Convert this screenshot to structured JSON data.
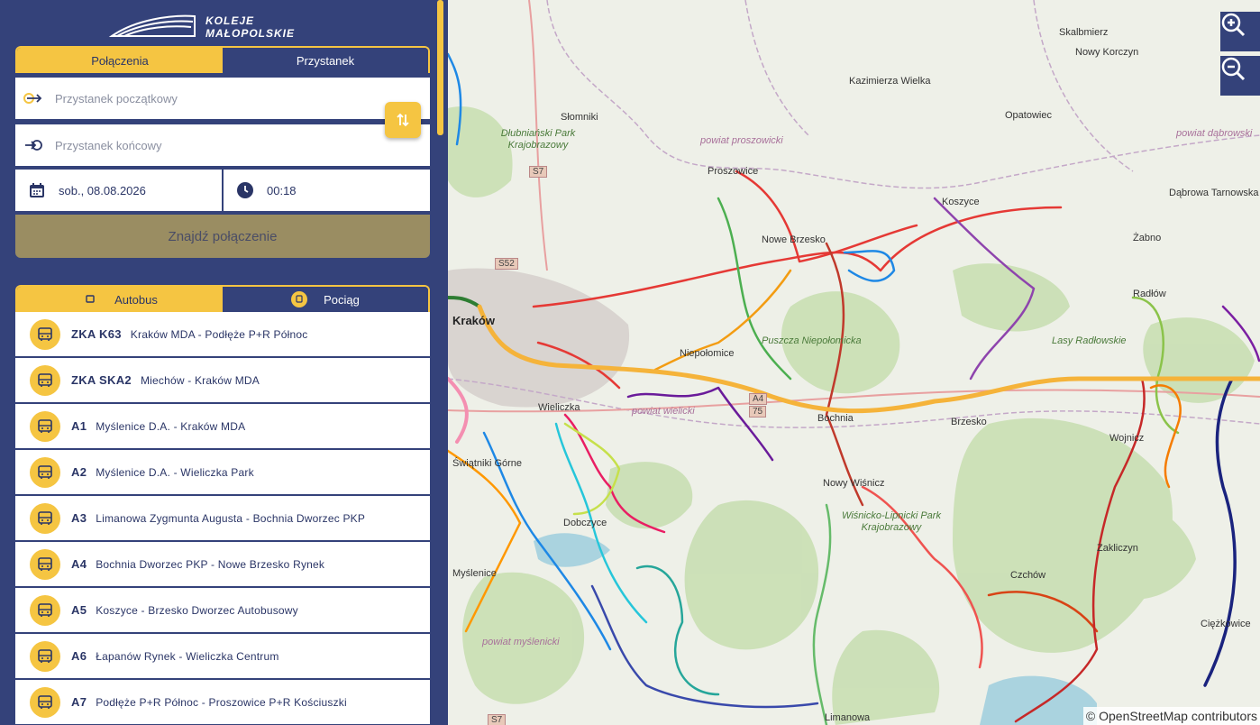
{
  "brand": {
    "line1": "KOLEJE",
    "line2": "MAŁOPOLSKIE"
  },
  "search_tabs": {
    "connections": "Połączenia",
    "stop": "Przystanek"
  },
  "search": {
    "from_placeholder": "Przystanek początkowy",
    "to_placeholder": "Przystanek końcowy",
    "date": "sob., 08.08.2026",
    "time": "00:18",
    "find_label": "Znajdź połączenie"
  },
  "mode_tabs": {
    "bus": "Autobus",
    "train": "Pociąg"
  },
  "routes": [
    {
      "code": "ZKA K63",
      "name": "Kraków MDA - Podłęże P+R Północ"
    },
    {
      "code": "ZKA SKA2",
      "name": "Miechów - Kraków MDA"
    },
    {
      "code": "A1",
      "name": "Myślenice D.A. - Kraków MDA"
    },
    {
      "code": "A2",
      "name": "Myślenice D.A. - Wieliczka Park"
    },
    {
      "code": "A3",
      "name": "Limanowa Zygmunta Augusta - Bochnia Dworzec PKP"
    },
    {
      "code": "A4",
      "name": "Bochnia Dworzec PKP - Nowe Brzesko Rynek"
    },
    {
      "code": "A5",
      "name": "Koszyce - Brzesko Dworzec Autobusowy"
    },
    {
      "code": "A6",
      "name": "Łapanów Rynek - Wieliczka Centrum"
    },
    {
      "code": "A7",
      "name": "Podłęże P+R Północ - Proszowice P+R Kościuszki"
    }
  ],
  "map": {
    "attribution": "© OpenStreetMap contributors",
    "places": [
      {
        "name": "Skalbmierz",
        "kind": "town"
      },
      {
        "name": "Nowy Korczyn",
        "kind": "town"
      },
      {
        "name": "Kazimierza Wielka",
        "kind": "town"
      },
      {
        "name": "Słomniki",
        "kind": "town"
      },
      {
        "name": "Opatowiec",
        "kind": "town"
      },
      {
        "name": "Dłubniański Park Krajobrazowy",
        "kind": "park"
      },
      {
        "name": "powiat proszowicki",
        "kind": "district"
      },
      {
        "name": "powiat dąbrowski",
        "kind": "district"
      },
      {
        "name": "Proszowice",
        "kind": "town"
      },
      {
        "name": "Koszyce",
        "kind": "town"
      },
      {
        "name": "Dąbrowa Tarnowska",
        "kind": "town"
      },
      {
        "name": "Nowe Brzesko",
        "kind": "town"
      },
      {
        "name": "Żabno",
        "kind": "town"
      },
      {
        "name": "Kraków",
        "kind": "city"
      },
      {
        "name": "Radłów",
        "kind": "town"
      },
      {
        "name": "Niepołomice",
        "kind": "town"
      },
      {
        "name": "Puszcza Niepołomicka",
        "kind": "park"
      },
      {
        "name": "Lasy Radłowskie",
        "kind": "park"
      },
      {
        "name": "Wieliczka",
        "kind": "town"
      },
      {
        "name": "powiat wielicki",
        "kind": "district"
      },
      {
        "name": "Bochnia",
        "kind": "town"
      },
      {
        "name": "Brzesko",
        "kind": "town"
      },
      {
        "name": "Wojnicz",
        "kind": "town"
      },
      {
        "name": "Świątniki Górne",
        "kind": "town"
      },
      {
        "name": "Nowy Wiśnicz",
        "kind": "town"
      },
      {
        "name": "Wiśnicko-Lipnicki Park Krajobrazowy",
        "kind": "park"
      },
      {
        "name": "Dobczyce",
        "kind": "town"
      },
      {
        "name": "Zakliczyn",
        "kind": "town"
      },
      {
        "name": "Myślenice",
        "kind": "town"
      },
      {
        "name": "Czchów",
        "kind": "town"
      },
      {
        "name": "powiat myślenicki",
        "kind": "district"
      },
      {
        "name": "Ciężkowice",
        "kind": "town"
      },
      {
        "name": "Limanowa",
        "kind": "town"
      }
    ],
    "road_shields": [
      "S7",
      "S52",
      "A4",
      "75",
      "S7"
    ]
  },
  "colors": {
    "navy": "#34427a",
    "yellow": "#f5c542",
    "find_button": "#9a8d62"
  }
}
